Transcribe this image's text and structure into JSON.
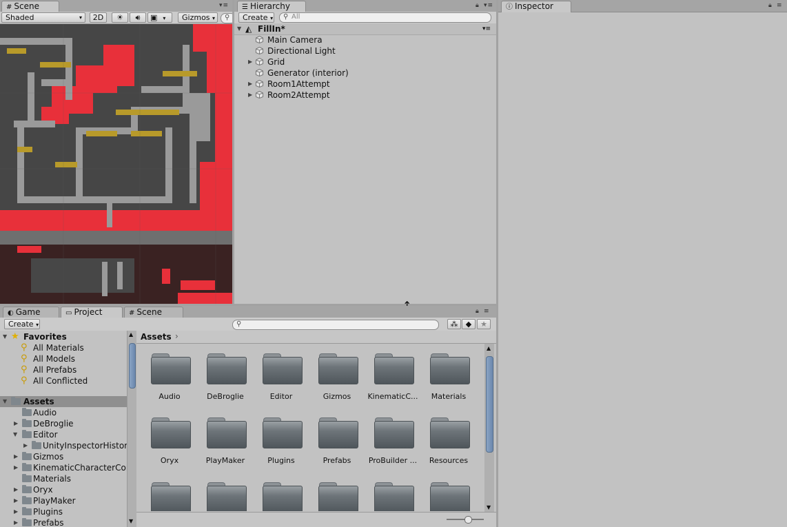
{
  "scene_panel": {
    "tab_label": "Scene",
    "shading_mode": "Shaded",
    "mode_2d": "2D",
    "gizmos_label": "Gizmos"
  },
  "hierarchy": {
    "tab_label": "Hierarchy",
    "create_label": "Create",
    "search_placeholder": "All",
    "scene_name": "FillIn*",
    "items": [
      {
        "label": "Main Camera",
        "expandable": false
      },
      {
        "label": "Directional Light",
        "expandable": false
      },
      {
        "label": "Grid",
        "expandable": true
      },
      {
        "label": "Generator (interior)",
        "expandable": false
      },
      {
        "label": "Room1Attempt",
        "expandable": true
      },
      {
        "label": "Room2Attempt",
        "expandable": true
      }
    ]
  },
  "inspector": {
    "tab_label": "Inspector"
  },
  "bottom_tabs": [
    {
      "label": "Game",
      "icon": "game-icon"
    },
    {
      "label": "Project",
      "icon": "folder-icon"
    },
    {
      "label": "Scene",
      "icon": "scene-icon"
    }
  ],
  "project": {
    "create_label": "Create",
    "favorites": {
      "label": "Favorites",
      "items": [
        "All Materials",
        "All Models",
        "All Prefabs",
        "All Conflicted"
      ]
    },
    "assets_tree": {
      "label": "Assets",
      "items": [
        {
          "label": "Audio",
          "level": 1,
          "expander": "none"
        },
        {
          "label": "DeBroglie",
          "level": 1,
          "expander": "collapsed"
        },
        {
          "label": "Editor",
          "level": 1,
          "expander": "expanded"
        },
        {
          "label": "UnityInspectorHistory",
          "level": 2,
          "expander": "collapsed"
        },
        {
          "label": "Gizmos",
          "level": 1,
          "expander": "collapsed"
        },
        {
          "label": "KinematicCharacterCon",
          "level": 1,
          "expander": "collapsed"
        },
        {
          "label": "Materials",
          "level": 1,
          "expander": "none"
        },
        {
          "label": "Oryx",
          "level": 1,
          "expander": "collapsed"
        },
        {
          "label": "PlayMaker",
          "level": 1,
          "expander": "collapsed"
        },
        {
          "label": "Plugins",
          "level": 1,
          "expander": "collapsed"
        },
        {
          "label": "Prefabs",
          "level": 1,
          "expander": "collapsed"
        }
      ]
    },
    "breadcrumb": "Assets",
    "grid_folders": [
      "Audio",
      "DeBroglie",
      "Editor",
      "Gizmos",
      "KinematicC...",
      "Materials",
      "Oryx",
      "PlayMaker",
      "Plugins",
      "Prefabs",
      "ProBuilder ...",
      "Resources",
      "",
      "",
      "",
      "",
      "",
      ""
    ]
  },
  "colors": {
    "panel_bg": "#c2c2c2",
    "tab_bar": "#a5a5a5",
    "selection": "#8f8f8f",
    "lava": "#e8303a",
    "floor": "#474747",
    "wall": "#9a9a9a"
  }
}
